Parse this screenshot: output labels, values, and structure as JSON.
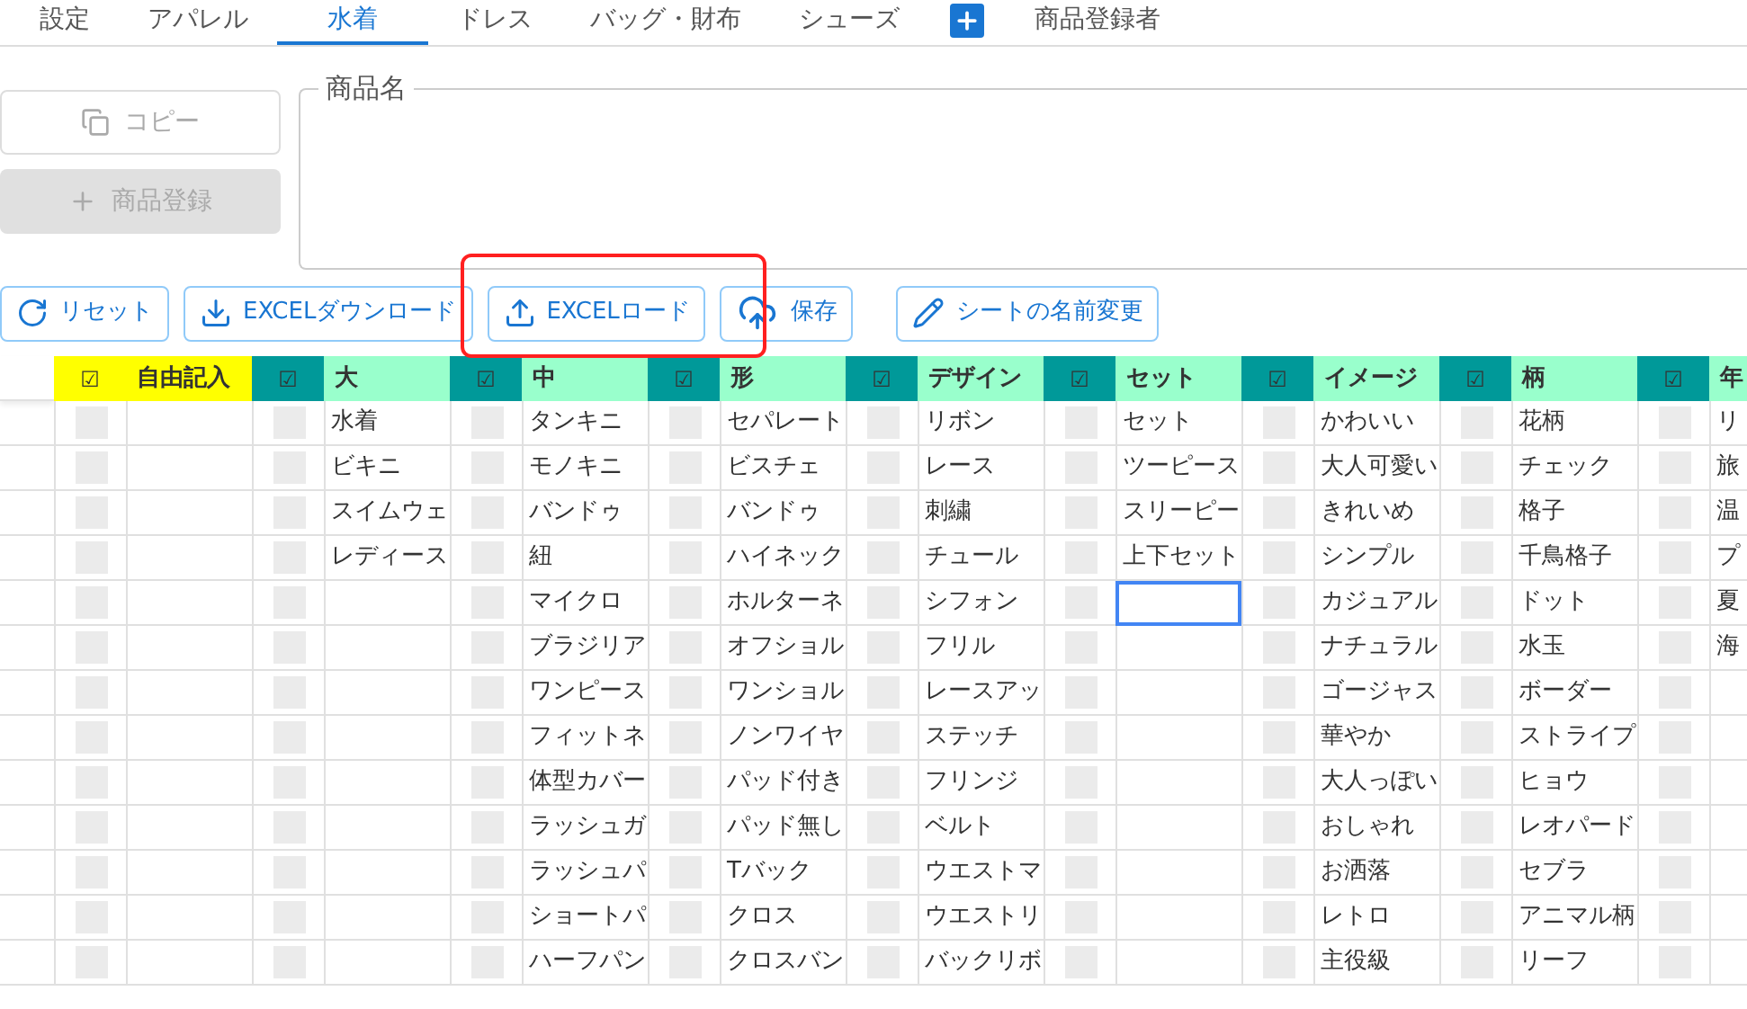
{
  "tabs": [
    {
      "kind": "text",
      "label": "設定",
      "selected": false
    },
    {
      "kind": "text",
      "label": "アパレル",
      "selected": false
    },
    {
      "kind": "text",
      "label": "水着",
      "selected": true
    },
    {
      "kind": "text",
      "label": "ドレス",
      "selected": false
    },
    {
      "kind": "text",
      "label": "バッグ・財布",
      "selected": false
    },
    {
      "kind": "text",
      "label": "シューズ",
      "selected": false
    },
    {
      "kind": "add",
      "selected": false
    },
    {
      "kind": "text",
      "label": "商品登録者",
      "selected": false
    }
  ],
  "side_buttons": [
    {
      "kind": "copy",
      "label": "コピー",
      "disabled": true
    },
    {
      "kind": "register",
      "label": "商品登録",
      "disabled": true
    }
  ],
  "product_name": {
    "label": "商品名"
  },
  "toolbar": [
    {
      "kind": "reset",
      "label": "リセット"
    },
    {
      "kind": "download",
      "label": "EXCELダウンロード"
    },
    {
      "kind": "upload",
      "label": "EXCELロード"
    },
    {
      "kind": "save",
      "label": "保存"
    },
    {
      "kind": "rename",
      "label": "シートの名前変更"
    }
  ],
  "table": {
    "columns": [
      {
        "kind": "free",
        "check": "☑",
        "label": "自由記入",
        "cells": [
          {
            "checked": false,
            "selected": false
          },
          {
            "checked": false,
            "selected": false
          },
          {
            "checked": false,
            "selected": false
          },
          {
            "checked": false,
            "selected": false
          },
          {
            "checked": false,
            "selected": false
          },
          {
            "checked": false,
            "selected": false
          },
          {
            "checked": false,
            "selected": false
          },
          {
            "checked": false,
            "selected": false
          },
          {
            "checked": false,
            "selected": false
          },
          {
            "checked": false,
            "selected": false
          },
          {
            "checked": false,
            "selected": false
          },
          {
            "checked": false,
            "selected": false
          },
          {
            "checked": false,
            "selected": false
          }
        ]
      },
      {
        "kind": "category",
        "check": "☑",
        "label": "大",
        "cells": [
          {
            "checked": false,
            "text": "水着",
            "selected": false
          },
          {
            "checked": false,
            "text": "ビキニ",
            "selected": false
          },
          {
            "checked": false,
            "text": "スイムウェ",
            "selected": false
          },
          {
            "checked": false,
            "text": "レディース",
            "selected": false
          },
          {
            "checked": false,
            "selected": false
          },
          {
            "checked": false,
            "selected": false
          },
          {
            "checked": false,
            "selected": false
          },
          {
            "checked": false,
            "selected": false
          },
          {
            "checked": false,
            "selected": false
          },
          {
            "checked": false,
            "selected": false
          },
          {
            "checked": false,
            "selected": false
          },
          {
            "checked": false,
            "selected": false
          },
          {
            "checked": false,
            "selected": false
          }
        ]
      },
      {
        "kind": "category",
        "check": "☑",
        "label": "中",
        "cells": [
          {
            "checked": false,
            "text": "タンキニ",
            "selected": false
          },
          {
            "checked": false,
            "text": "モノキニ",
            "selected": false
          },
          {
            "checked": false,
            "text": "バンドゥ",
            "selected": false
          },
          {
            "checked": false,
            "text": "紐",
            "selected": false
          },
          {
            "checked": false,
            "text": "マイクロ",
            "selected": false
          },
          {
            "checked": false,
            "text": "ブラジリア",
            "selected": false
          },
          {
            "checked": false,
            "text": "ワンピース",
            "selected": false
          },
          {
            "checked": false,
            "text": "フィットネ",
            "selected": false
          },
          {
            "checked": false,
            "text": "体型カバー",
            "selected": false
          },
          {
            "checked": false,
            "text": "ラッシュガ",
            "selected": false
          },
          {
            "checked": false,
            "text": "ラッシュパ",
            "selected": false
          },
          {
            "checked": false,
            "text": "ショートパ",
            "selected": false
          },
          {
            "checked": false,
            "text": "ハーフパン",
            "selected": false
          }
        ]
      },
      {
        "kind": "category",
        "check": "☑",
        "label": "形",
        "cells": [
          {
            "checked": false,
            "text": "セパレート",
            "selected": false
          },
          {
            "checked": false,
            "text": "ビスチェ",
            "selected": false
          },
          {
            "checked": false,
            "text": "バンドゥ",
            "selected": false
          },
          {
            "checked": false,
            "text": "ハイネック",
            "selected": false
          },
          {
            "checked": false,
            "text": "ホルターネ",
            "selected": false
          },
          {
            "checked": false,
            "text": "オフショル",
            "selected": false
          },
          {
            "checked": false,
            "text": "ワンショル",
            "selected": false
          },
          {
            "checked": false,
            "text": "ノンワイヤ",
            "selected": false
          },
          {
            "checked": false,
            "text": "パッド付き",
            "selected": false
          },
          {
            "checked": false,
            "text": "パッド無し",
            "selected": false
          },
          {
            "checked": false,
            "text": "Tバック",
            "selected": false
          },
          {
            "checked": false,
            "text": "クロス",
            "selected": false
          },
          {
            "checked": false,
            "text": "クロスバン",
            "selected": false
          }
        ]
      },
      {
        "kind": "category",
        "check": "☑",
        "label": "デザイン",
        "cells": [
          {
            "checked": false,
            "text": "リボン",
            "selected": false
          },
          {
            "checked": false,
            "text": "レース",
            "selected": false
          },
          {
            "checked": false,
            "text": "刺繍",
            "selected": false
          },
          {
            "checked": false,
            "text": "チュール",
            "selected": false
          },
          {
            "checked": false,
            "text": "シフォン",
            "selected": false
          },
          {
            "checked": false,
            "text": "フリル",
            "selected": false
          },
          {
            "checked": false,
            "text": "レースアッ",
            "selected": false
          },
          {
            "checked": false,
            "text": "ステッチ",
            "selected": false
          },
          {
            "checked": false,
            "text": "フリンジ",
            "selected": false
          },
          {
            "checked": false,
            "text": "ベルト",
            "selected": false
          },
          {
            "checked": false,
            "text": "ウエストマ",
            "selected": false
          },
          {
            "checked": false,
            "text": "ウエストリ",
            "selected": false
          },
          {
            "checked": false,
            "text": "バックリボ",
            "selected": false
          }
        ]
      },
      {
        "kind": "category",
        "check": "☑",
        "label": "セット",
        "cells": [
          {
            "checked": false,
            "text": "セット",
            "selected": false
          },
          {
            "checked": false,
            "text": "ツーピース",
            "selected": false
          },
          {
            "checked": false,
            "text": "スリーピー",
            "selected": false
          },
          {
            "checked": false,
            "text": "上下セット",
            "selected": false
          },
          {
            "checked": false,
            "selected": true
          },
          {
            "checked": false,
            "selected": false
          },
          {
            "checked": false,
            "selected": false
          },
          {
            "checked": false,
            "selected": false
          },
          {
            "checked": false,
            "selected": false
          },
          {
            "checked": false,
            "selected": false
          },
          {
            "checked": false,
            "selected": false
          },
          {
            "checked": false,
            "selected": false
          },
          {
            "checked": false,
            "selected": false
          }
        ]
      },
      {
        "kind": "category",
        "check": "☑",
        "label": "イメージ",
        "cells": [
          {
            "checked": false,
            "text": "かわいい",
            "selected": false
          },
          {
            "checked": false,
            "text": "大人可愛い",
            "selected": false
          },
          {
            "checked": false,
            "text": "きれいめ",
            "selected": false
          },
          {
            "checked": false,
            "text": "シンプル",
            "selected": false
          },
          {
            "checked": false,
            "text": "カジュアル",
            "selected": false
          },
          {
            "checked": false,
            "text": "ナチュラル",
            "selected": false
          },
          {
            "checked": false,
            "text": "ゴージャス",
            "selected": false
          },
          {
            "checked": false,
            "text": "華やか",
            "selected": false
          },
          {
            "checked": false,
            "text": "大人っぽい",
            "selected": false
          },
          {
            "checked": false,
            "text": "おしゃれ",
            "selected": false
          },
          {
            "checked": false,
            "text": "お洒落",
            "selected": false
          },
          {
            "checked": false,
            "text": "レトロ",
            "selected": false
          },
          {
            "checked": false,
            "text": "主役級",
            "selected": false
          }
        ]
      },
      {
        "kind": "category",
        "check": "☑",
        "label": "柄",
        "cells": [
          {
            "checked": false,
            "text": "花柄",
            "selected": false
          },
          {
            "checked": false,
            "text": "チェック",
            "selected": false
          },
          {
            "checked": false,
            "text": "格子",
            "selected": false
          },
          {
            "checked": false,
            "text": "千鳥格子",
            "selected": false
          },
          {
            "checked": false,
            "text": "ドット",
            "selected": false
          },
          {
            "checked": false,
            "text": "水玉",
            "selected": false
          },
          {
            "checked": false,
            "text": "ボーダー",
            "selected": false
          },
          {
            "checked": false,
            "text": "ストライプ",
            "selected": false
          },
          {
            "checked": false,
            "text": "ヒョウ",
            "selected": false
          },
          {
            "checked": false,
            "text": "レオパード",
            "selected": false
          },
          {
            "checked": false,
            "text": "セブラ",
            "selected": false
          },
          {
            "checked": false,
            "text": "アニマル柄",
            "selected": false
          },
          {
            "checked": false,
            "text": "リーフ",
            "selected": false
          }
        ]
      },
      {
        "kind": "category",
        "check": "☑",
        "label": "年",
        "cells": [
          {
            "checked": false,
            "text": "リ",
            "selected": false
          },
          {
            "checked": false,
            "text": "旅",
            "selected": false
          },
          {
            "checked": false,
            "text": "温",
            "selected": false
          },
          {
            "checked": false,
            "text": "プ",
            "selected": false
          },
          {
            "checked": false,
            "text": "夏",
            "selected": false
          },
          {
            "checked": false,
            "text": "海",
            "selected": false
          },
          {
            "checked": false,
            "selected": false
          },
          {
            "checked": false,
            "selected": false
          },
          {
            "checked": false,
            "selected": false
          },
          {
            "checked": false,
            "selected": false
          },
          {
            "checked": false,
            "selected": false
          },
          {
            "checked": false,
            "selected": false
          },
          {
            "checked": false,
            "selected": false
          }
        ]
      }
    ]
  }
}
